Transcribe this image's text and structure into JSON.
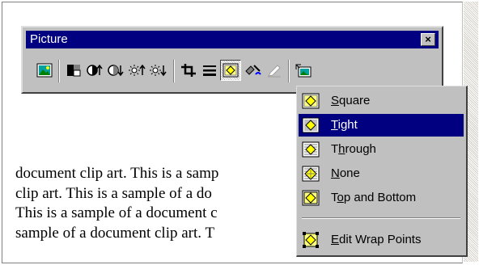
{
  "document": {
    "lines": [
      "document clip art. This is a samp",
      "clip art. This is a sample of a do",
      "This is a sample of a document c",
      "sample of a document clip art. T"
    ]
  },
  "toolbar": {
    "title": "Picture",
    "close_glyph": "×",
    "buttons": [
      {
        "name": "insert-picture-button",
        "icon": "insert-picture-icon"
      },
      {
        "name": "image-control-button",
        "icon": "image-control-icon"
      },
      {
        "name": "more-contrast-button",
        "icon": "more-contrast-icon"
      },
      {
        "name": "less-contrast-button",
        "icon": "less-contrast-icon"
      },
      {
        "name": "more-brightness-button",
        "icon": "more-brightness-icon"
      },
      {
        "name": "less-brightness-button",
        "icon": "less-brightness-icon"
      },
      {
        "name": "crop-button",
        "icon": "crop-icon"
      },
      {
        "name": "line-style-button",
        "icon": "line-style-icon"
      },
      {
        "name": "text-wrapping-button",
        "icon": "text-wrapping-icon"
      },
      {
        "name": "format-picture-button",
        "icon": "format-picture-icon"
      },
      {
        "name": "set-transparent-color-button",
        "icon": "set-transparent-color-icon"
      },
      {
        "name": "reset-picture-button",
        "icon": "reset-picture-icon"
      }
    ]
  },
  "wrap_menu": {
    "items": [
      {
        "pre": "",
        "acc": "S",
        "post": "quare"
      },
      {
        "pre": "",
        "acc": "T",
        "post": "ight"
      },
      {
        "pre": "T",
        "acc": "h",
        "post": "rough"
      },
      {
        "pre": "",
        "acc": "N",
        "post": "one"
      },
      {
        "pre": "T",
        "acc": "o",
        "post": "p and Bottom"
      },
      {
        "pre": "",
        "acc": "E",
        "post": "dit Wrap Points"
      }
    ],
    "selected_index": 1
  },
  "colors": {
    "titlebar": "#000080",
    "face": "#c0c0c0",
    "selection": "#000080"
  }
}
